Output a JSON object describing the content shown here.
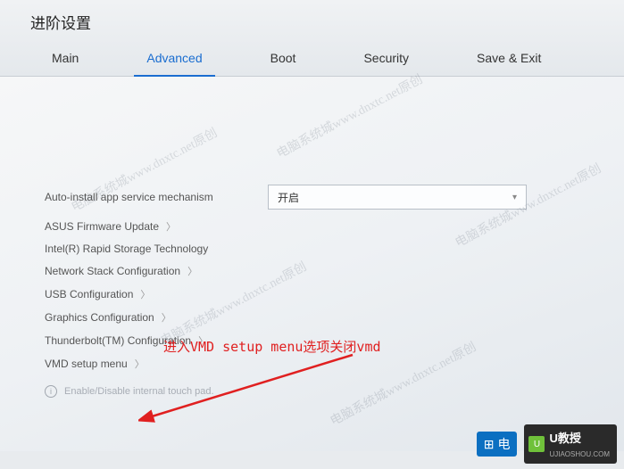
{
  "title": "进阶设置",
  "tabs": [
    {
      "label": "Main"
    },
    {
      "label": "Advanced",
      "active": true
    },
    {
      "label": "Boot"
    },
    {
      "label": "Security"
    },
    {
      "label": "Save & Exit"
    }
  ],
  "setting_row": {
    "label": "Auto-install app service mechanism",
    "value": "开启"
  },
  "items": {
    "asus_fw": "ASUS Firmware Update",
    "intel_rst": "Intel(R) Rapid Storage Technology",
    "net_stack": "Network Stack Configuration",
    "usb": "USB Configuration",
    "graphics": "Graphics Configuration",
    "thunderbolt": "Thunderbolt(TM) Configuration",
    "vmd": "VMD setup menu"
  },
  "hint": "Enable/Disable internal touch pad.",
  "annotation": "进入VMD setup menu选项关闭vmd",
  "watermark_text": "电脑系统城www.dnxtc.net原创",
  "logos": {
    "dian": "电",
    "u_brand": "U教授",
    "u_sub": "UJIAOSHOU.COM"
  }
}
